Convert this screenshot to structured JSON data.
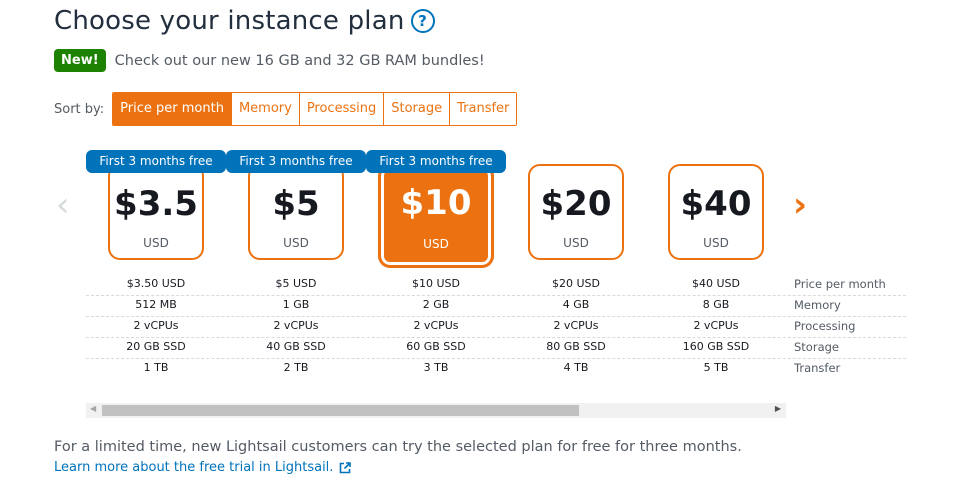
{
  "header": {
    "title": "Choose your instance plan",
    "help_icon": "?"
  },
  "promo": {
    "badge": "New!",
    "text": "Check out our new 16 GB and 32 GB RAM bundles!"
  },
  "sort": {
    "label": "Sort by:",
    "options": [
      "Price per month",
      "Memory",
      "Processing",
      "Storage",
      "Transfer"
    ],
    "selected": "Price per month"
  },
  "plans": [
    {
      "price": "$3.5",
      "currency": "USD",
      "badge": "First 3 months free",
      "price_per_month": "$3.50 USD",
      "memory": "512 MB",
      "processing": "2 vCPUs",
      "storage": "20 GB SSD",
      "transfer": "1 TB"
    },
    {
      "price": "$5",
      "currency": "USD",
      "badge": "First 3 months free",
      "price_per_month": "$5 USD",
      "memory": "1 GB",
      "processing": "2 vCPUs",
      "storage": "40 GB SSD",
      "transfer": "2 TB"
    },
    {
      "price": "$10",
      "currency": "USD",
      "badge": "First 3 months free",
      "selected": true,
      "price_per_month": "$10 USD",
      "memory": "2 GB",
      "processing": "2 vCPUs",
      "storage": "60 GB SSD",
      "transfer": "3 TB"
    },
    {
      "price": "$20",
      "currency": "USD",
      "price_per_month": "$20 USD",
      "memory": "4 GB",
      "processing": "2 vCPUs",
      "storage": "80 GB SSD",
      "transfer": "4 TB"
    },
    {
      "price": "$40",
      "currency": "USD",
      "price_per_month": "$40 USD",
      "memory": "8 GB",
      "processing": "2 vCPUs",
      "storage": "160 GB SSD",
      "transfer": "5 TB"
    }
  ],
  "spec_labels": {
    "price_per_month": "Price per month",
    "memory": "Memory",
    "processing": "Processing",
    "storage": "Storage",
    "transfer": "Transfer"
  },
  "icons": {
    "prev": "chevron-left-icon",
    "next": "chevron-right-icon",
    "external": "external-link-icon"
  },
  "colors": {
    "accent": "#ec7211",
    "badge_blue": "#0073bb",
    "badge_green": "#1d8102"
  },
  "footer": {
    "text": "For a limited time, new Lightsail customers can try the selected plan for free for three months.",
    "link": "Learn more about the free trial in Lightsail."
  }
}
